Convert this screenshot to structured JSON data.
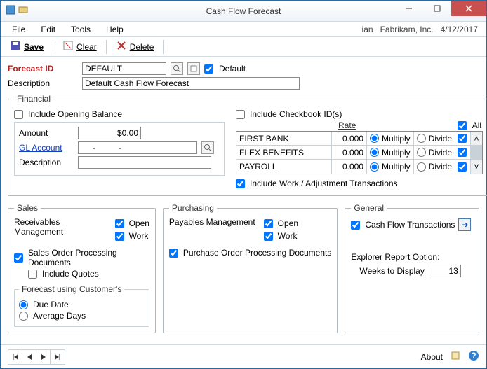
{
  "window": {
    "title": "Cash Flow Forecast"
  },
  "menubar": {
    "file": "File",
    "edit": "Edit",
    "tools": "Tools",
    "help": "Help",
    "user": "ian",
    "company": "Fabrikam, Inc.",
    "date": "4/12/2017"
  },
  "toolbar": {
    "save": "Save",
    "clear": "Clear",
    "delete": "Delete"
  },
  "forecast": {
    "id_label": "Forecast ID",
    "id_value": "DEFAULT",
    "default_label": "Default",
    "desc_label": "Description",
    "desc_value": "Default Cash Flow Forecast"
  },
  "financial": {
    "legend": "Financial",
    "ob_label": "Include Opening Balance",
    "amount_label": "Amount",
    "amount_value": "$0.00",
    "gl_label": "GL Account",
    "gl_value": "     -          -",
    "desc_label": "Description",
    "desc_value": "",
    "cb_label": "Include Checkbook ID(s)",
    "rate_hdr": "Rate",
    "all_label": "All",
    "rows": [
      {
        "name": "FIRST BANK",
        "rate": "0.000",
        "mult": "Multiply",
        "div": "Divide"
      },
      {
        "name": "FLEX BENEFITS",
        "rate": "0.000",
        "mult": "Multiply",
        "div": "Divide"
      },
      {
        "name": "PAYROLL",
        "rate": "0.000",
        "mult": "Multiply",
        "div": "Divide"
      }
    ],
    "work_adj": "Include Work / Adjustment Transactions"
  },
  "sales": {
    "legend": "Sales",
    "rm": "Receivables Management",
    "open": "Open",
    "work": "Work",
    "sop": "Sales Order Processing Documents",
    "quotes": "Include Quotes",
    "forecast_using": "Forecast using Customer's",
    "due": "Due Date",
    "avg": "Average Days"
  },
  "purchasing": {
    "legend": "Purchasing",
    "pm": "Payables Management",
    "open": "Open",
    "work": "Work",
    "pop": "Purchase Order Processing Documents"
  },
  "general": {
    "legend": "General",
    "cft": "Cash Flow Transactions",
    "ero": "Explorer Report Option:",
    "wtd": "Weeks to Display",
    "wtd_value": "13"
  },
  "status": {
    "about": "About"
  }
}
